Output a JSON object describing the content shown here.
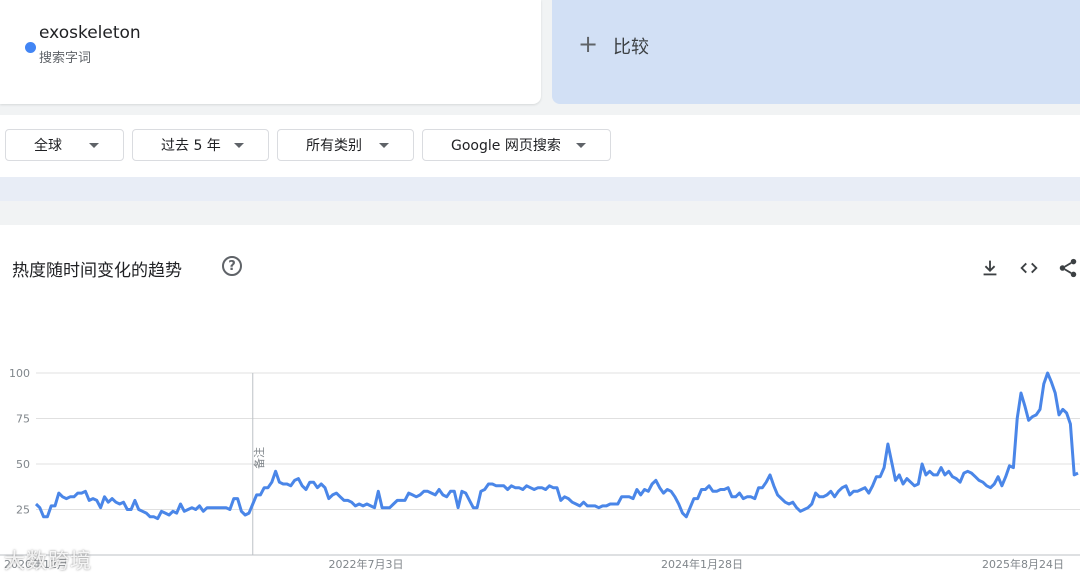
{
  "search_term": {
    "name": "exoskeleton",
    "sublabel": "搜索字词",
    "color": "#4285f4"
  },
  "compare": {
    "label": "比较"
  },
  "filters": {
    "region": "全球",
    "time": "过去 5 年",
    "category": "所有类别",
    "search_type": "Google 网页搜索"
  },
  "chart_section": {
    "title": "热度随时间变化的趋势",
    "help_icon": "help-circle-icon",
    "tools": [
      "download-icon",
      "embed-code-icon",
      "share-icon"
    ]
  },
  "chart_data": {
    "type": "line",
    "ylim": [
      0,
      100
    ],
    "yticks": [
      25,
      50,
      75,
      100
    ],
    "xtick_labels": [
      "2020年12月",
      "2022年7月3日",
      "2024年1月28日",
      "2025年8月24日"
    ],
    "annotation": "备注",
    "line_color": "#4a86e8",
    "series": [
      {
        "values": [
          28,
          26,
          21,
          21,
          27,
          27,
          34,
          32,
          31,
          32,
          32,
          34,
          34,
          35,
          30,
          31,
          30,
          26,
          32,
          29,
          31,
          29,
          28,
          29,
          25,
          25,
          30,
          25,
          24,
          23,
          21,
          21,
          20,
          24,
          23,
          22,
          24,
          23,
          28,
          24,
          25,
          26,
          25,
          27,
          24,
          26,
          26,
          26,
          26,
          26,
          26,
          25,
          31,
          31,
          24,
          22,
          23,
          28,
          33,
          33,
          37,
          37,
          40,
          46,
          40,
          39,
          39,
          38,
          41,
          42,
          38,
          36,
          40,
          40,
          37,
          39,
          37,
          31,
          33,
          34,
          32,
          30,
          30,
          29,
          27,
          28,
          27,
          28,
          27,
          26,
          35,
          26,
          26,
          26,
          28,
          30,
          30,
          30,
          34,
          33,
          32,
          33,
          35,
          35,
          34,
          33,
          36,
          33,
          32,
          35,
          35,
          26,
          35,
          34,
          30,
          26,
          26,
          35,
          36,
          39,
          39,
          38,
          38,
          38,
          36,
          38,
          37,
          37,
          36,
          38,
          37,
          36,
          37,
          37,
          36,
          38,
          37,
          37,
          30,
          32,
          31,
          29,
          28,
          27,
          29,
          27,
          27,
          27,
          26,
          27,
          27,
          28,
          28,
          28,
          32,
          32,
          32,
          31,
          36,
          33,
          36,
          35,
          39,
          41,
          37,
          34,
          36,
          35,
          32,
          28,
          23,
          21,
          26,
          31,
          31,
          36,
          36,
          38,
          35,
          35,
          36,
          36,
          37,
          32,
          32,
          34,
          31,
          32,
          32,
          31,
          37,
          37,
          40,
          44,
          38,
          33,
          31,
          29,
          28,
          29,
          26,
          24,
          25,
          26,
          28,
          34,
          32,
          32,
          33,
          35,
          32,
          35,
          37,
          38,
          33,
          35,
          35,
          36,
          37,
          34,
          38,
          43,
          43,
          48,
          61,
          51,
          41,
          44,
          39,
          42,
          40,
          38,
          39,
          50,
          44,
          46,
          44,
          44,
          48,
          44,
          46,
          43,
          42,
          40,
          45,
          46,
          45,
          43,
          41,
          40,
          38,
          37,
          39,
          43,
          38,
          43,
          49,
          48,
          75,
          89,
          82,
          74,
          76,
          77,
          80,
          94,
          100,
          95,
          89,
          77,
          80,
          78,
          72,
          44,
          45
        ]
      }
    ]
  },
  "watermark": "大数跨境"
}
